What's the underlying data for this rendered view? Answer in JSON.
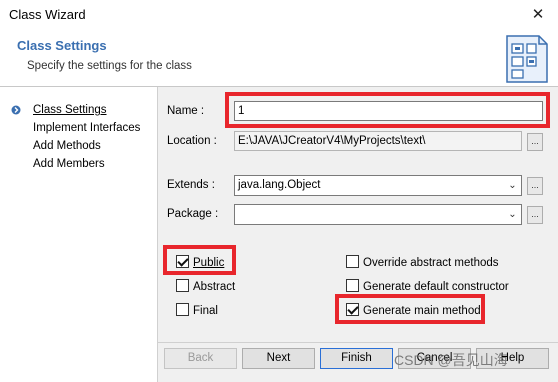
{
  "window": {
    "title": "Class Wizard",
    "close_glyph": "✕"
  },
  "header": {
    "title": "Class Settings",
    "subtitle": "Specify the settings for the class",
    "icon": "class-wizard-icon"
  },
  "nav": {
    "items": [
      {
        "label": "Class Settings",
        "active": true
      },
      {
        "label": "Implement Interfaces"
      },
      {
        "label": "Add Methods"
      },
      {
        "label": "Add Members"
      }
    ]
  },
  "form": {
    "name": {
      "label": "Name :",
      "value": "1"
    },
    "location": {
      "label": "Location :",
      "value": "E:\\JAVA\\JCreatorV4\\MyProjects\\text\\",
      "browse": "..."
    },
    "extends": {
      "label": "Extends :",
      "value": "java.lang.Object",
      "browse": "..."
    },
    "package": {
      "label": "Package :",
      "value": "",
      "browse": "..."
    }
  },
  "options": {
    "public": {
      "label": "Public",
      "checked": true
    },
    "abstract": {
      "label": "Abstract",
      "checked": false
    },
    "final": {
      "label": "Final",
      "checked": false
    },
    "override_abstract": {
      "label": "Override abstract methods",
      "checked": false
    },
    "generate_ctor": {
      "label": "Generate default constructor",
      "checked": false
    },
    "generate_main": {
      "label": "Generate main method",
      "checked": true
    }
  },
  "buttons": {
    "back": "Back",
    "next": "Next",
    "finish": "Finish",
    "cancel": "Cancel",
    "help": "Help"
  },
  "watermark": "CSDN @吾见山海",
  "colors": {
    "header_title": "#3a6fb0",
    "highlight": "#e8262c",
    "default_button_border": "#2a6fd6"
  }
}
